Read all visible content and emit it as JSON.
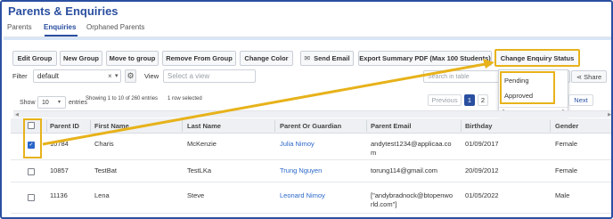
{
  "page": {
    "title": "Parents & Enquiries"
  },
  "tabs": [
    "Parents",
    "Enquiries",
    "Orphaned Parents"
  ],
  "toolbar": {
    "edit_group": "Edit Group",
    "new_group": "New Group",
    "move_to_group": "Move to group",
    "remove_from_group": "Remove From Group",
    "change_color": "Change Color",
    "send_email": "Send Email",
    "export_summary": "Export Summary PDF (Max 100 Students)",
    "change_enquiry_status": "Change Enquiry Status"
  },
  "filter": {
    "label": "Filter",
    "value": "default",
    "clear": "×",
    "caret": "▾",
    "view_label": "View",
    "view_placeholder": "Select a view"
  },
  "search": {
    "placeholder": "Search in table"
  },
  "share": {
    "label": "Share"
  },
  "status_dropdown": {
    "options": [
      "Pending",
      "Approved"
    ]
  },
  "length": {
    "show": "Show",
    "value": "10",
    "entries": "entries"
  },
  "info": {
    "showing": "Showing 1 to 10 of 260 entries",
    "selected": "1 row selected"
  },
  "pagination": {
    "previous": "Previous",
    "pages": [
      "1",
      "2"
    ],
    "next": "Next"
  },
  "table": {
    "columns": [
      "Parent ID",
      "First Name",
      "Last Name",
      "Parent Or Guardian",
      "Parent Email",
      "Birthday",
      "Gender"
    ],
    "rows": [
      {
        "checked": true,
        "id": "10784",
        "first": "Charis",
        "last": "McKenzie",
        "guardian": "Julia Nimoy",
        "email1": "andytest1234@applicaa.co",
        "email2": "m",
        "birthday": "01/09/2017",
        "gender": "Female"
      },
      {
        "checked": false,
        "id": "10857",
        "first": "TestBat",
        "last": "TestLKa",
        "guardian": "Trung Nguyen",
        "email1": "torung114@gmail.com",
        "email2": "",
        "birthday": "20/09/2012",
        "gender": "Female"
      },
      {
        "checked": false,
        "id": "11136",
        "first": "Lena",
        "last": "Steve",
        "guardian": "Leonard Nimoy",
        "email1": "[\"andybradnock@btopenwo",
        "email2": "rld.com\"]",
        "birthday": "01/05/2022",
        "gender": "Male"
      }
    ]
  },
  "colors": {
    "brand": "#2a4fa0",
    "highlight": "#e7b21a",
    "link": "#2a66c9"
  }
}
